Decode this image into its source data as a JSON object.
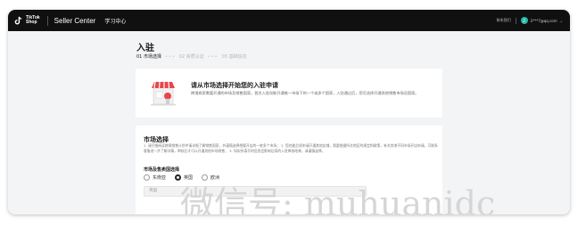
{
  "header": {
    "logo_line1": "TikTok",
    "logo_line2": "Shop",
    "title": "Seller Center",
    "nav_item": "学习中心",
    "contact": "联系我们",
    "avatar_letter": "Z",
    "account_email": "2***7@qq.com",
    "caret": "⌄"
  },
  "page": {
    "title": "入驻",
    "steps": [
      {
        "label": "01 市场选择",
        "active": true
      },
      {
        "label": "02 资质认证",
        "active": false
      },
      {
        "label": "03 基础信息",
        "active": false
      }
    ],
    "step_dots": "•••"
  },
  "intro": {
    "title": "请从市场选择开始您的入驻申请",
    "description": "跨境商家需要开通的市场及销售国家。首次入驻仅能开通唯一市场下的一个或多个国家，入驻通过后，您可选择开通其他销售市场及国家。"
  },
  "market": {
    "title": "市场选择",
    "description": "1. 请仔细阅读跨境销售计划中请详细了解销售国家，并谨慎选择想要开店的一款多个市场； 2. 您也能后续申请开通其他店铺，需要根据所在地区的规定和政策，有关其他不同市场开店申请，可联系客服进一步了解详情，审核后才可以开通其他市场销售； 3. 如实所填写的信息会影响后续的入驻审核结果，请谨慎选择。",
    "select_label": "市场及售卖国选择",
    "options": [
      {
        "label": "东南亚",
        "selected": false
      },
      {
        "label": "英国",
        "selected": true
      },
      {
        "label": "欧洲",
        "selected": false
      }
    ],
    "region_placeholder": "英国"
  },
  "watermark": "微信号: muhuanidc",
  "colors": {
    "header_bg": "#101010",
    "accent_teal": "#26b8a5",
    "accent_red": "#e8454a"
  }
}
